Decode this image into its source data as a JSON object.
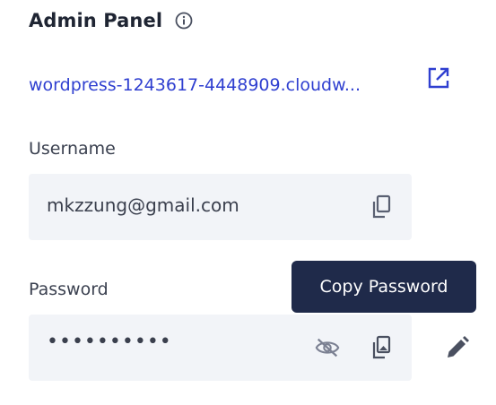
{
  "header": {
    "title": "Admin Panel"
  },
  "site": {
    "link_text": "wordpress-1243617-4448909.cloudw..."
  },
  "username": {
    "label": "Username",
    "value": "mkzzung@gmail.com"
  },
  "password": {
    "label": "Password",
    "masked_value": "••••••••••"
  },
  "tooltip": {
    "text": "Copy Password"
  },
  "icons": {
    "info": "info-icon",
    "external": "external-link-icon",
    "copy": "copy-icon",
    "visibility_off": "eye-off-icon",
    "edit": "pencil-icon"
  },
  "colors": {
    "link": "#2f3fd0",
    "field_bg": "#f2f4f8",
    "tooltip_bg": "#1f2a4a",
    "icon": "#5a6072"
  }
}
